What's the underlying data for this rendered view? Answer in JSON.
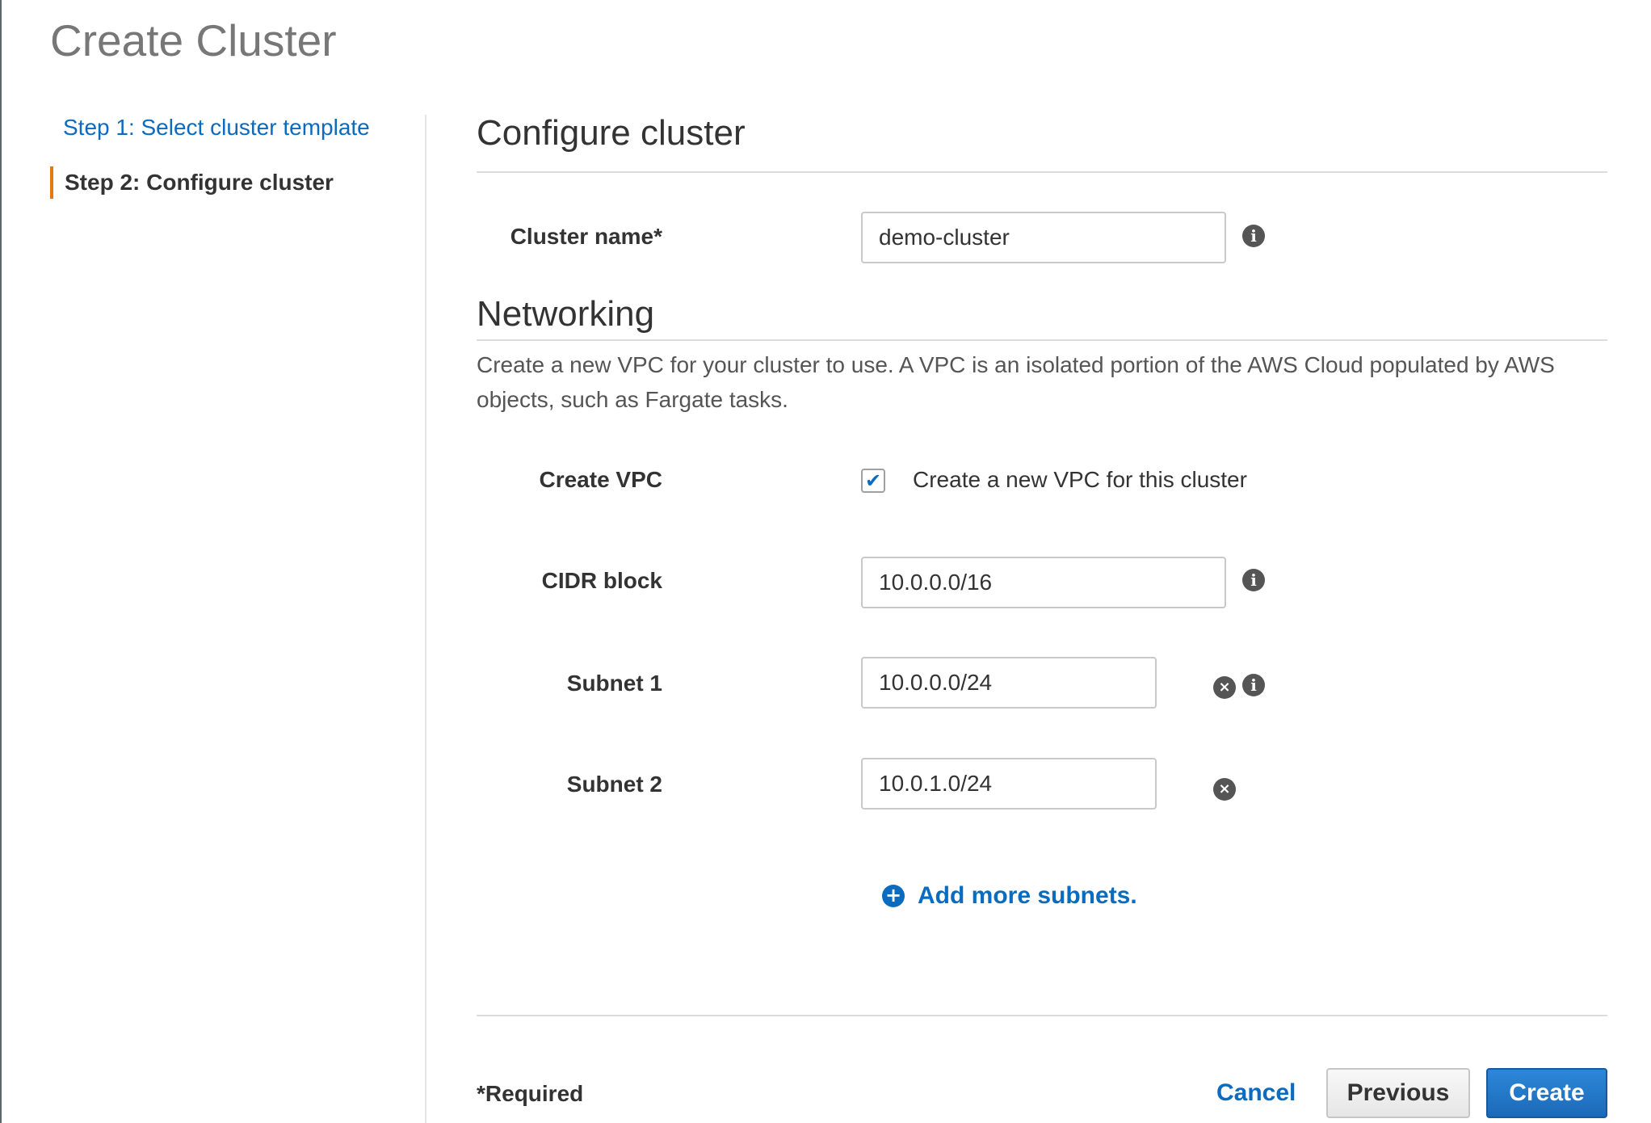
{
  "page": {
    "title": "Create Cluster"
  },
  "steps": [
    {
      "label": "Step 1: Select cluster template",
      "active": false
    },
    {
      "label": "Step 2: Configure cluster",
      "active": true
    }
  ],
  "configure": {
    "title": "Configure cluster",
    "cluster_name": {
      "label": "Cluster name*",
      "value": "demo-cluster"
    }
  },
  "networking": {
    "title": "Networking",
    "description": "Create a new VPC for your cluster to use. A VPC is an isolated portion of the AWS Cloud populated by AWS objects, such as Fargate tasks.",
    "create_vpc": {
      "label": "Create VPC",
      "checked": true,
      "checkbox_text": "Create a new VPC for this cluster",
      "check_glyph": "✔"
    },
    "cidr_block": {
      "label": "CIDR block",
      "value": "10.0.0.0/16"
    },
    "subnets": [
      {
        "label": "Subnet 1",
        "value": "10.0.0.0/24"
      },
      {
        "label": "Subnet 2",
        "value": "10.0.1.0/24"
      }
    ],
    "add_subnets_label": "Add more subnets."
  },
  "icons": {
    "info": "i",
    "remove": "×",
    "add": "+"
  },
  "footer": {
    "required_note": "*Required",
    "cancel_label": "Cancel",
    "previous_label": "Previous",
    "create_label": "Create"
  },
  "colors": {
    "link": "#0a6bbf",
    "active_step_marker": "#e47911",
    "primary_button": "#1b6ab9"
  }
}
